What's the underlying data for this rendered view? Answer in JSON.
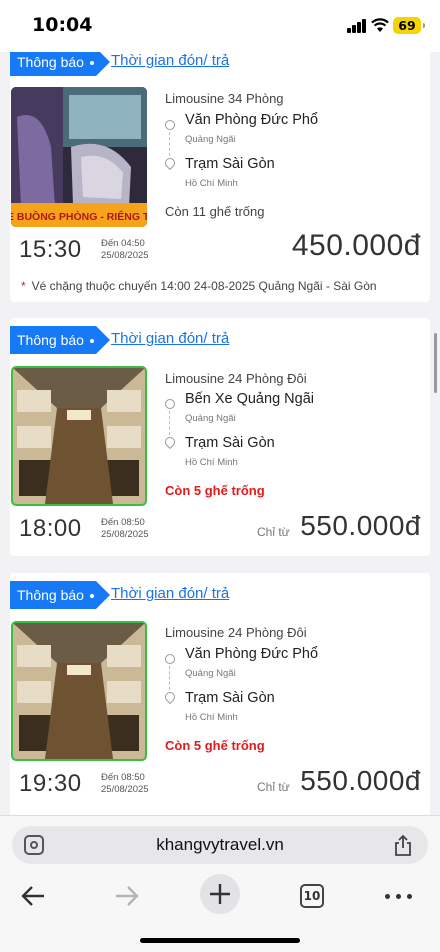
{
  "status_bar": {
    "time": "10:04",
    "battery": "69"
  },
  "cards": [
    {
      "notice": "Thông báo",
      "pickup_link": "Thời gian đón/ trả",
      "photo_caption": "XE BUỒNG PHÒNG - RIÊNG TƯ",
      "bus_type": "Limousine 34 Phòng",
      "from": {
        "name": "Văn Phòng Đức Phổ",
        "sub": "Quảng Ngãi"
      },
      "to": {
        "name": "Trạm Sài Gòn",
        "sub": "Hồ Chí Minh"
      },
      "seats": "Còn 11 ghế trống",
      "depart": "15:30",
      "arrive_label": "Đến 04:50",
      "arrive_date": "25/08/2025",
      "price_prefix": "",
      "price": "450.000đ",
      "note": "Vé chặng thuộc chuyến 14:00 24-08-2025 Quảng Ngãi - Sài Gòn"
    },
    {
      "notice": "Thông báo",
      "pickup_link": "Thời gian đón/ trả",
      "bus_type": "Limousine 24 Phòng Đôi",
      "from": {
        "name": "Bến Xe Quảng Ngãi",
        "sub": "Quảng Ngãi"
      },
      "to": {
        "name": "Trạm Sài Gòn",
        "sub": "Hồ Chí Minh"
      },
      "seats": "Còn 5 ghế trống",
      "depart": "18:00",
      "arrive_label": "Đến 08:50",
      "arrive_date": "25/08/2025",
      "price_prefix": "Chỉ từ",
      "price": "550.000đ"
    },
    {
      "notice": "Thông báo",
      "pickup_link": "Thời gian đón/ trả",
      "bus_type": "Limousine 24 Phòng Đôi",
      "from": {
        "name": "Văn Phòng Đức Phổ",
        "sub": "Quảng Ngãi"
      },
      "to": {
        "name": "Trạm Sài Gòn",
        "sub": "Hồ Chí Minh"
      },
      "seats": "Còn 5 ghế trống",
      "depart": "19:30",
      "arrive_label": "Đến 08:50",
      "arrive_date": "25/08/2025",
      "price_prefix": "Chỉ từ",
      "price": "550.000đ"
    }
  ],
  "browser": {
    "url": "khangvytravel.vn",
    "tab_count": "10"
  },
  "colors": {
    "accent": "#1679f5",
    "link": "#1a73e8",
    "alert": "#e01b1b",
    "photo_border": "#37c043"
  }
}
